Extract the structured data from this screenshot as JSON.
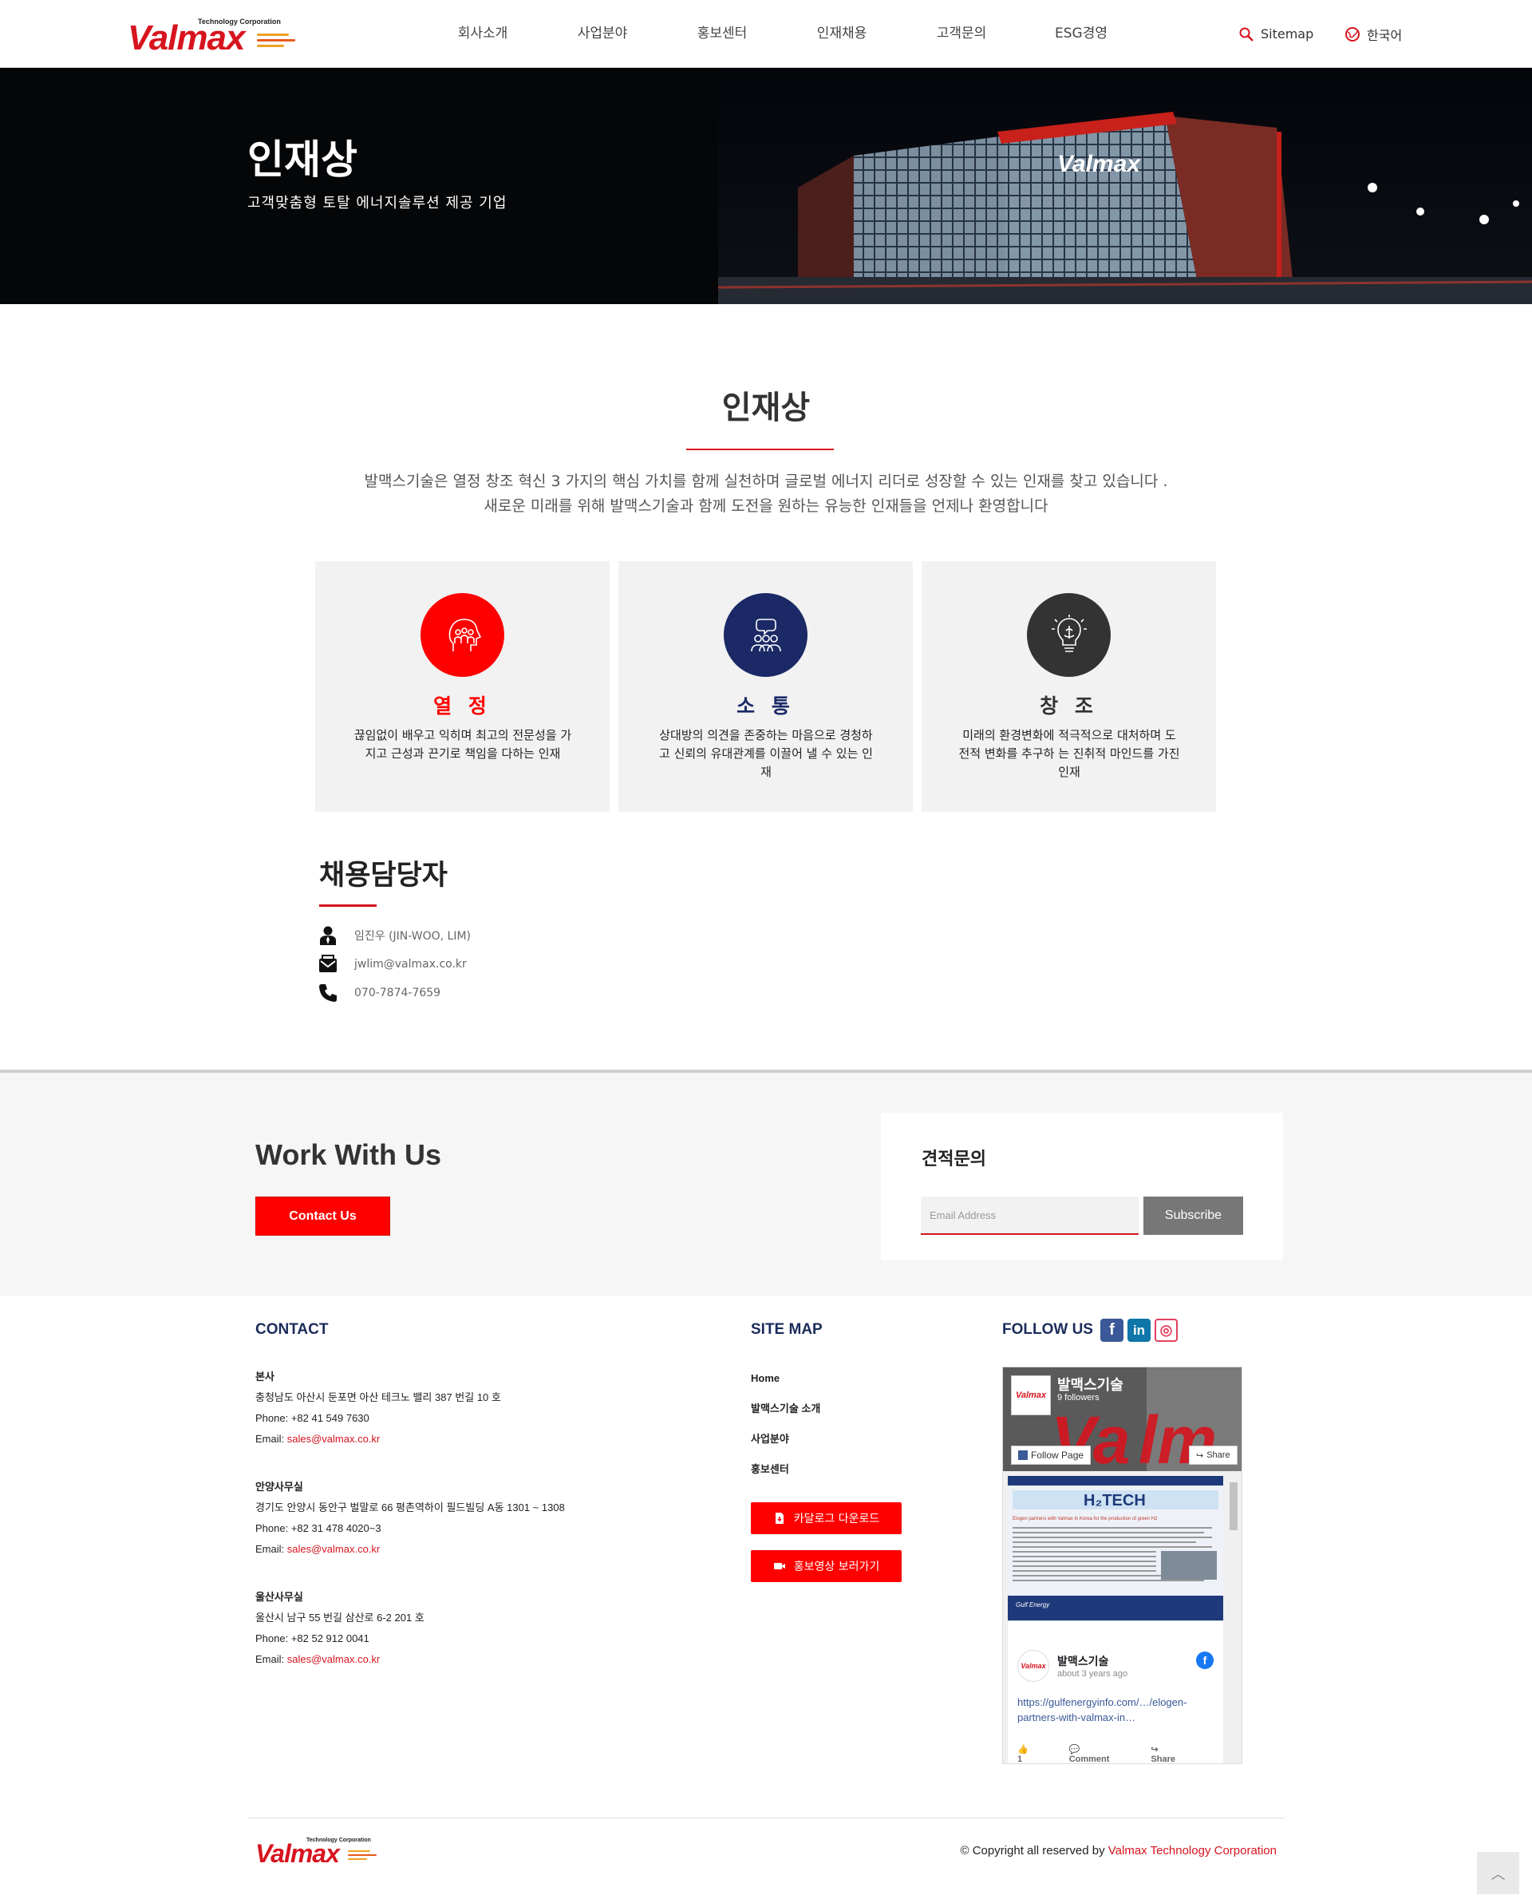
{
  "header": {
    "logo": {
      "main": "Valmax",
      "sub": "Technology Corporation"
    },
    "nav": [
      "회사소개",
      "사업분야",
      "홍보센터",
      "인재채용",
      "고객문의",
      "ESG경영"
    ],
    "sitemap_label": "Sitemap",
    "language_label": "한국어"
  },
  "hero": {
    "title": "인재상",
    "subtitle": "고객맞춤형 토탈 에너지솔루션 제공 기업",
    "sign_text": "Valmax"
  },
  "intro": {
    "title": "인재상",
    "desc_line1": "발맥스기술은 열정 창조 혁신 3 가지의 핵심 가치를 함께 실천하며 글로벌 에너지 리더로 성장할 수 있는 인재를 찾고 있습니다 .",
    "desc_line2": "새로운 미래를 위해 발맥스기술과 함께 도전을 원하는 유능한 인재들을 언제나 환영합니다"
  },
  "values": [
    {
      "title": "열 정",
      "text": "끊임없이 배우고 익히며 최고의 전문성을 가지고 근성과 끈기로 책임을 다하는 인재",
      "color": "#fe0000",
      "icon": "team-head-icon"
    },
    {
      "title": "소 통",
      "text": "상대방의 의견을 존중하는 마음으로 경청하고 신뢰의 유대관계를 이끌어 낼 수 있는 인재",
      "color": "#1b2a66",
      "icon": "people-chat-icon"
    },
    {
      "title": "창 조",
      "text": "미래의 환경변화에 적극적으로 대처하며 도전적 변화를 추구하 는 진취적 마인드를 가진 인재",
      "color": "#333333",
      "icon": "lightbulb-brain-icon"
    }
  ],
  "recruiter": {
    "title": "채용담당자",
    "name": "임진우 (JIN-WOO, LIM)",
    "email": "jwlim@valmax.co.kr",
    "phone": "070-7874-7659"
  },
  "work": {
    "title": "Work With Us",
    "contact_button": "Contact Us",
    "quote_title": "견적문의",
    "email_placeholder": "Email Address",
    "subscribe_button": "Subscribe"
  },
  "footer": {
    "contact_heading": "CONTACT",
    "offices": [
      {
        "name": "본사",
        "address": "충청남도 아산시 둔포면 아산 테크노 밸리 387 번길 10 호",
        "phone": "Phone: +82 41 549 7630",
        "email_label": "Email: ",
        "email": "sales@valmax.co.kr"
      },
      {
        "name": "안양사무실",
        "address": "경기도 안양시 동안구 벌말로 66 평촌역하이 필드빌딩 A동 1301 ~ 1308",
        "phone": "Phone: +82 31 478 4020~3",
        "email_label": "Email: ",
        "email": "sales@valmax.co.kr"
      },
      {
        "name": "울산사무실",
        "address": "울산시 남구 55 번길 삼산로 6-2 201 호",
        "phone": "Phone: +82 52 912 0041",
        "email_label": "Email: ",
        "email": "sales@valmax.co.kr"
      }
    ],
    "sitemap_heading": "SITE MAP",
    "sitemap_links": [
      "Home",
      "발맥스기술 소개",
      "사업분야",
      "홍보센터"
    ],
    "catalog_button": "카달로그 다운로드",
    "video_button": "홍보영상 보러가기",
    "follow_heading": "FOLLOW US",
    "social": [
      {
        "name": "facebook",
        "color": "#3b5998",
        "glyph": "f"
      },
      {
        "name": "linkedin",
        "color": "#0e76a8",
        "glyph": "in"
      },
      {
        "name": "instagram",
        "color": "#e4405f",
        "glyph": "◎"
      }
    ],
    "fb_widget": {
      "page_name": "발맥스기술",
      "followers": "9 followers",
      "follow_label": "Follow Page",
      "share_label": "Share",
      "post_name": "발맥스기술",
      "post_time": "about 3 years ago",
      "post_link": "https://gulfenergyinfo.com/…/elogen-partners-with-valmax-in…",
      "post_image_title": "H₂TECH",
      "post_image_headline": "Elogen partners with Valmax in Korea for the production of green H2",
      "likes": "1",
      "comment_label": "Comment",
      "share_action_label": "Share",
      "avatar_text": "Valmax"
    },
    "copyright_prefix": "© Copyright all reserved by ",
    "copyright_corp": "Valmax Technology Corporation"
  }
}
